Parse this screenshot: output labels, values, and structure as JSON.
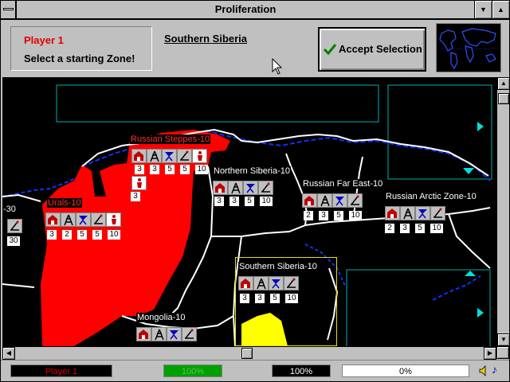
{
  "window": {
    "title": "Proliferation"
  },
  "header": {
    "player_name": "Player 1",
    "prompt": "Select a starting Zone!",
    "selected_zone": "Southern Siberia",
    "accept_label": "Accept Selection",
    "accept_shortcut": "A"
  },
  "map": {
    "zones": [
      {
        "name": "Russian Steppes-10",
        "owned": true,
        "stats": [
          "3",
          "3",
          "5",
          "5",
          "10"
        ],
        "extra_stat": "3"
      },
      {
        "name": "Northern Siberia-10",
        "owned": false,
        "stats": [
          "3",
          "3",
          "5",
          "10"
        ]
      },
      {
        "name": "Urals-10",
        "owned": true,
        "stats": [
          "3",
          "2",
          "5",
          "5",
          "10"
        ]
      },
      {
        "name": "Russian Far East-10",
        "owned": false,
        "stats": [
          "2",
          "3",
          "5",
          "10"
        ]
      },
      {
        "name": "Russian Arctic Zone-10",
        "owned": false,
        "stats": [
          "2",
          "3",
          "5",
          "10"
        ]
      },
      {
        "name": "Southern Siberia-10",
        "owned": false,
        "stats": [
          "3",
          "3",
          "5",
          "10"
        ]
      },
      {
        "name": "Mongolia-10",
        "owned": false,
        "stats": []
      },
      {
        "name": "-30",
        "owned": false,
        "stats": [
          "30"
        ]
      }
    ],
    "icon_set": [
      "factory-icon",
      "oil-derrick-icon",
      "radar-dish-icon",
      "missile-launcher-icon"
    ]
  },
  "status_bar": {
    "player": "Player 1",
    "progress_a": "100%",
    "progress_a_fraction": 1.0,
    "progress_b": "100%",
    "progress_c": "0%"
  },
  "colors": {
    "player_red": "#ff0000",
    "selected_yellow": "#ffff00",
    "water_outline": "#0000ff",
    "border_white": "#ffffff",
    "cyan_frame": "#00c8c8"
  }
}
